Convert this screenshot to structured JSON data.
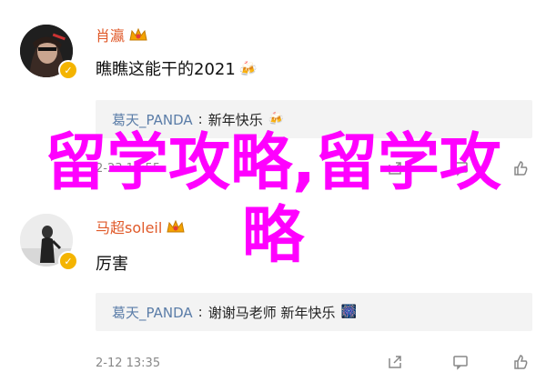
{
  "comments": [
    {
      "username": "肖瀛",
      "text": "瞧瞧这能干的2021",
      "text_emoji": "🍻",
      "replies": [
        {
          "user": "葛天_PANDA",
          "sep": ":",
          "text": "新年快乐",
          "emoji": "🍻"
        }
      ],
      "timestamp": "2-23 11:55"
    },
    {
      "username": "马超soleil",
      "text": "厉害",
      "replies": [
        {
          "user": "葛天_PANDA",
          "sep": ":",
          "text": "谢谢马老师 新年快乐",
          "emoji": "🎆"
        }
      ],
      "timestamp": "2-12 13:35"
    }
  ],
  "overlay": {
    "text": "留学攻略,留学攻略",
    "color": "#ff00ff"
  },
  "colors": {
    "username": "#e05a2a",
    "reply_user": "#5b7da8",
    "verified_badge": "#f4b400"
  },
  "icons": {
    "verified": "verified-badge-icon",
    "crown": "crown-icon",
    "share": "share-icon",
    "comment": "comment-icon",
    "like": "like-icon"
  }
}
